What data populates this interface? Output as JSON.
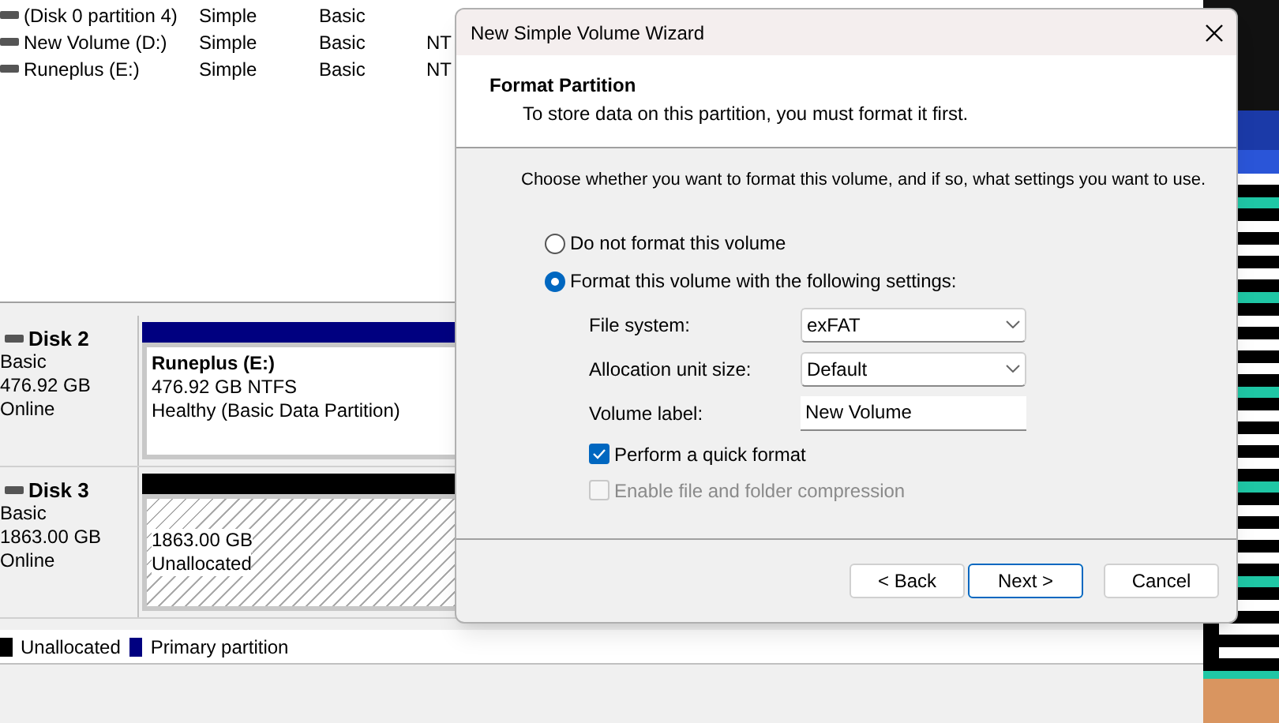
{
  "volume_list": {
    "rows": [
      {
        "volume": "(Disk 0 partition 4)",
        "layout": "Simple",
        "type": "Basic"
      },
      {
        "volume": "New Volume (D:)",
        "layout": "Simple",
        "type": "Basic",
        "file_system": "NT"
      },
      {
        "volume": "Runeplus (E:)",
        "layout": "Simple",
        "type": "Basic",
        "file_system": "NT"
      }
    ]
  },
  "disks": [
    {
      "name": "Disk 2",
      "type": "Basic",
      "size": "476.92 GB",
      "status": "Online",
      "partition": {
        "kind": "primary",
        "name": "Runeplus  (E:)",
        "size": "476.92 GB NTFS",
        "status": "Healthy (Basic Data Partition)"
      }
    },
    {
      "name": "Disk 3",
      "type": "Basic",
      "size": "1863.00 GB",
      "status": "Online",
      "partition": {
        "kind": "unallocated",
        "size": "1863.00 GB",
        "status": "Unallocated"
      }
    }
  ],
  "legend": [
    {
      "label": "Unallocated",
      "color": "#000000"
    },
    {
      "label": "Primary partition",
      "color": "#000080"
    }
  ],
  "wizard": {
    "title": "New Simple Volume Wizard",
    "heading": "Format Partition",
    "subheading": "To store data on this partition, you must format it first.",
    "instruction": "Choose whether you want to format this volume, and if so, what settings you want to use.",
    "options": [
      {
        "label": "Do not format this volume",
        "selected": false
      },
      {
        "label": "Format this volume with the following settings:",
        "selected": true
      }
    ],
    "fields": [
      {
        "kind": "select",
        "label": "File system:",
        "value": "exFAT"
      },
      {
        "kind": "select",
        "label": "Allocation unit size:",
        "value": "Default"
      },
      {
        "kind": "text",
        "label": "Volume label:",
        "value": "New Volume"
      }
    ],
    "checkboxes": [
      {
        "label": "Perform a quick format",
        "checked": true,
        "disabled": false
      },
      {
        "label": "Enable file and folder compression",
        "checked": false,
        "disabled": true
      }
    ],
    "buttons": [
      {
        "label": "< Back",
        "default": false
      },
      {
        "label": "Next >",
        "default": true
      },
      {
        "label": "Cancel",
        "default": false
      }
    ]
  }
}
